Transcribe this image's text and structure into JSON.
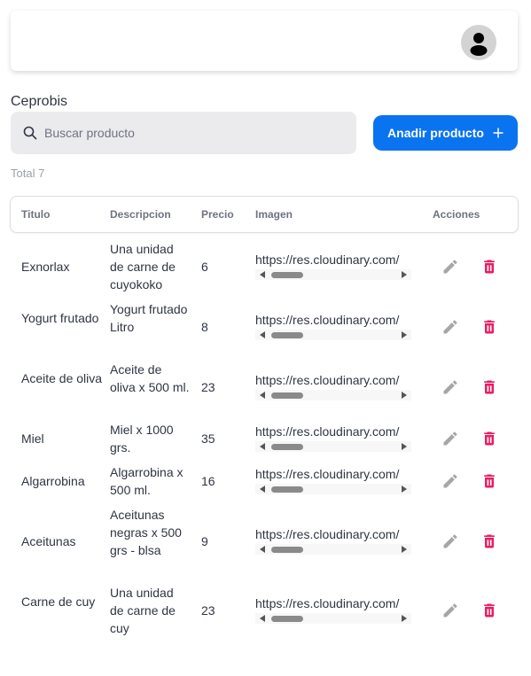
{
  "header": {
    "avatar_icon": "user-avatar-icon"
  },
  "brand": "Ceprobis",
  "search": {
    "placeholder": "Buscar producto",
    "value": "",
    "icon": "search-icon"
  },
  "add_button": {
    "label": "Anadir producto",
    "icon": "plus-icon"
  },
  "total": "Total 7",
  "table": {
    "columns": [
      "Titulo",
      "Descripcion",
      "Precio",
      "Imagen",
      "Acciones"
    ],
    "rows": [
      {
        "titulo": "Exnorlax",
        "descripcion": "Una unidad de carne de cuyokoko",
        "precio": "6",
        "imagen": "https://res.cloudinary.com/"
      },
      {
        "titulo": "Yogurt frutado",
        "descripcion": "Yogurt frutado Litro",
        "precio": "8",
        "imagen": "https://res.cloudinary.com/"
      },
      {
        "titulo": "Aceite de oliva",
        "descripcion": "Aceite de oliva x 500 ml.",
        "precio": "23",
        "imagen": "https://res.cloudinary.com/"
      },
      {
        "titulo": "Miel",
        "descripcion": "Miel x 1000 grs.",
        "precio": "35",
        "imagen": "https://res.cloudinary.com/"
      },
      {
        "titulo": "Algarrobina",
        "descripcion": "Algarrobina x 500 ml.",
        "precio": "16",
        "imagen": "https://res.cloudinary.com/"
      },
      {
        "titulo": "Aceitunas",
        "descripcion": "Aceitunas negras x 500 grs - blsa",
        "precio": "9",
        "imagen": "https://res.cloudinary.com/"
      },
      {
        "titulo": "Carne de cuy",
        "descripcion": "Una unidad de carne de cuy",
        "precio": "23",
        "imagen": "https://res.cloudinary.com/"
      }
    ],
    "action_icons": {
      "edit": "edit-icon",
      "delete": "trash-icon"
    }
  },
  "colors": {
    "primary": "#0a74f0",
    "delete": "#e91e63",
    "edit": "#9e9e9e",
    "search_bg": "#ebebed"
  }
}
